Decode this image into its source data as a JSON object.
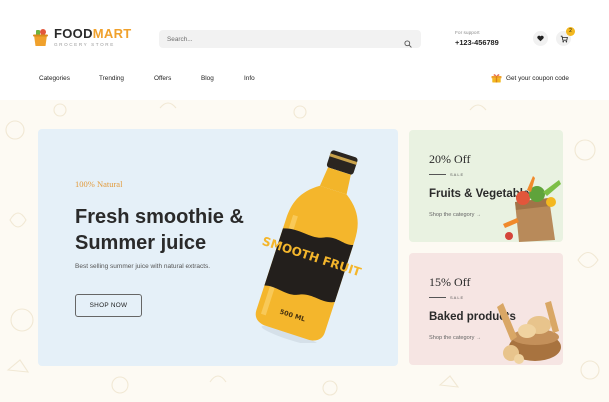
{
  "header": {
    "logo": {
      "title_part1": "FOOD",
      "title_part2": "MART",
      "subtitle": "GROCERY STORE"
    },
    "search": {
      "placeholder": "Search..."
    },
    "support": {
      "label": "For support",
      "phone": "+123-456789"
    },
    "cart_count": "2"
  },
  "nav": {
    "items": [
      "Categories",
      "Trending",
      "Offers",
      "Blog",
      "Info"
    ],
    "coupon_label": "Get your coupon code"
  },
  "hero": {
    "eyebrow": "100% Natural",
    "title": "Fresh smoothie & Summer juice",
    "description": "Best selling summer juice with natural extracts.",
    "button_label": "SHOP NOW",
    "product_label": "SMOOTH FRUIT",
    "product_volume": "500 ML"
  },
  "promos": [
    {
      "discount": "20% Off",
      "sale_label": "SALE",
      "title": "Fruits & Vegetables",
      "link": "Shop the category"
    },
    {
      "discount": "15% Off",
      "sale_label": "SALE",
      "title": "Baked products",
      "link": "Shop the category"
    }
  ],
  "colors": {
    "accent_orange": "#f0a12c",
    "badge_yellow": "#f3b81f",
    "hero_bg": "#e5f0f8",
    "promo_green_bg": "#e9f2e1",
    "promo_pink_bg": "#f6e5e3"
  }
}
